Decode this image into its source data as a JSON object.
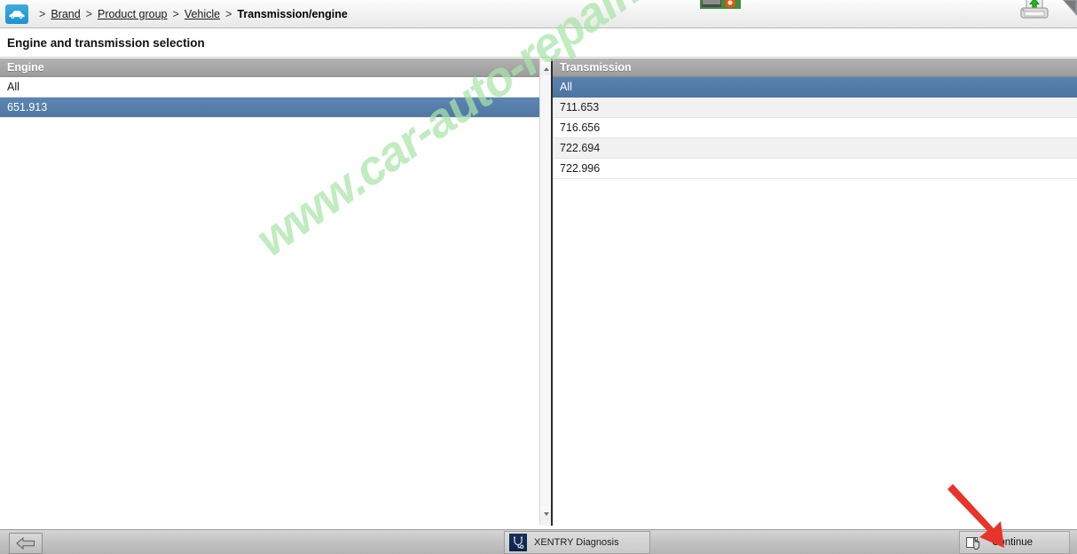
{
  "breadcrumb": {
    "home_icon": "car-icon",
    "separator": ">",
    "items": [
      {
        "label": "Brand",
        "current": false
      },
      {
        "label": "Product group",
        "current": false
      },
      {
        "label": "Vehicle",
        "current": false
      },
      {
        "label": "Transmission/engine",
        "current": true
      }
    ]
  },
  "toolbar": {
    "folder_icon": "folder-photo-icon",
    "upload_icon": "upload-to-printer-icon",
    "corner_icon": "partial-arrow-icon"
  },
  "header": {
    "page_title": "Engine and transmission selection"
  },
  "engine_panel": {
    "header": "Engine",
    "rows": [
      {
        "label": "All",
        "selected": false
      },
      {
        "label": "651.913",
        "selected": true
      }
    ],
    "scrollbar": {
      "up_icon": "scroll-up-arrow-icon",
      "down_icon": "scroll-down-arrow-icon"
    }
  },
  "transmission_panel": {
    "header": "Transmission",
    "rows": [
      {
        "label": "All",
        "selected": true
      },
      {
        "label": "711.653",
        "selected": false
      },
      {
        "label": "716.656",
        "selected": false
      },
      {
        "label": "722.694",
        "selected": false
      },
      {
        "label": "722.996",
        "selected": false
      }
    ]
  },
  "bottom_bar": {
    "back_icon": "back-arrow-icon",
    "taskbar": {
      "icon": "stethoscope-icon",
      "label": "XENTRY Diagnosis"
    },
    "continue": {
      "icon": "hand-click-icon",
      "label": "Continue"
    }
  },
  "watermark": {
    "text": "www.car-auto-repair.com"
  },
  "annotation": {
    "arrow": "red-arrow-pointing-to-continue"
  },
  "colors": {
    "selection_blue": "#4f78a3",
    "panel_header_gray": "#a6a6a6",
    "breadcrumb_icon_blue": "#1c93cf",
    "watermark_green": "#a8e6a8",
    "annotation_red": "#e8342a"
  }
}
